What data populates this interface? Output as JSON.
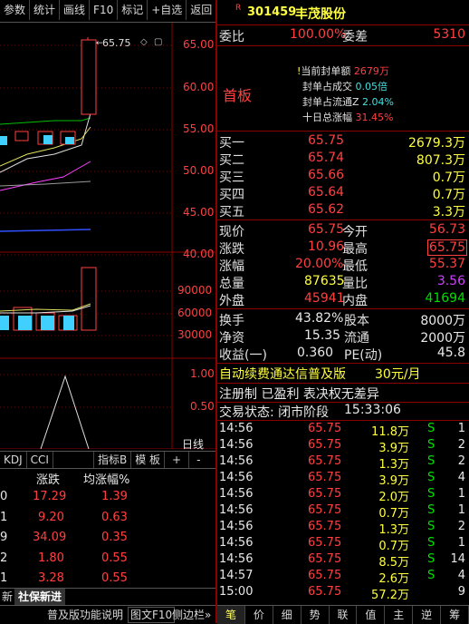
{
  "toolbar": [
    "参数",
    "统计",
    "画线",
    "F10",
    "标记",
    "+自选",
    "返回"
  ],
  "price_axis": [
    "65.00",
    "60.00",
    "55.00",
    "50.00",
    "45.00",
    "40.00"
  ],
  "high_label": "65.75",
  "volume_axis": [
    "90000",
    "60000",
    "30000"
  ],
  "indicator_axis": [
    "1.00",
    "0.50"
  ],
  "period_label": "日线",
  "indicator_tabs": [
    "KDJ",
    "CCI",
    "指标B",
    "模 板",
    "+",
    "-"
  ],
  "sector_table": {
    "headers": [
      "涨跌",
      "均涨幅%"
    ],
    "rows": [
      {
        "idx": "0",
        "chg": "17.29",
        "avg": "1.39"
      },
      {
        "idx": "1",
        "chg": "9.20",
        "avg": "0.63"
      },
      {
        "idx": "9",
        "chg": "34.09",
        "avg": "0.35"
      },
      {
        "idx": "2",
        "chg": "1.80",
        "avg": "0.55"
      },
      {
        "idx": "1",
        "chg": "3.28",
        "avg": "0.55"
      }
    ]
  },
  "news_tab": {
    "prefix": "新",
    "label": "社保新进"
  },
  "left_footer": "普及版功能说明",
  "left_footer_right": "图文F10",
  "left_footer_sidebar": "侧边栏»",
  "stock": {
    "code": "301459",
    "name": "丰茂股份",
    "badge": "R"
  },
  "weibi": {
    "label": "委比",
    "value": "100.00%",
    "cha_label": "委差",
    "cha_value": "5310"
  },
  "limit_up": {
    "title": "首板",
    "rows": [
      {
        "label": "当前封单额",
        "value": "2679万"
      },
      {
        "label": "封单占成交",
        "value": "0.05倍"
      },
      {
        "label": "封单占流通Z",
        "value": "2.04%"
      },
      {
        "label": "十日总涨幅",
        "value": "31.45%"
      }
    ]
  },
  "orderbook": [
    {
      "label": "买一",
      "price": "65.75",
      "vol": "2679.3万"
    },
    {
      "label": "买二",
      "price": "65.74",
      "vol": "807.3万"
    },
    {
      "label": "买三",
      "price": "65.66",
      "vol": "0.7万"
    },
    {
      "label": "买四",
      "price": "65.64",
      "vol": "0.7万"
    },
    {
      "label": "买五",
      "price": "65.62",
      "vol": "3.3万"
    }
  ],
  "quote": [
    {
      "l1": "现价",
      "v1": "65.75",
      "l2": "今开",
      "v2": "56.73"
    },
    {
      "l1": "涨跌",
      "v1": "10.96",
      "l2": "最高",
      "v2": "65.75"
    },
    {
      "l1": "涨幅",
      "v1": "20.00%",
      "l2": "最低",
      "v2": "55.37"
    },
    {
      "l1": "总量",
      "v1": "87635",
      "l2": "量比",
      "v2": "3.56"
    },
    {
      "l1": "外盘",
      "v1": "45941",
      "l2": "内盘",
      "v2": "41694"
    }
  ],
  "fundamentals": [
    {
      "l1": "换手",
      "v1": "43.82%",
      "l2": "股本",
      "v2": "8000万"
    },
    {
      "l1": "净资",
      "v1": "15.35",
      "l2": "流通",
      "v2": "2000万"
    },
    {
      "l1": "收益(一)",
      "v1": "0.360",
      "l2": "PE(动)",
      "v2": "45.8"
    }
  ],
  "ad_text": "自动续费通达信普及版",
  "ad_price": "30元/月",
  "registry_text": "注册制 已盈利 表决权无差异",
  "trade_status": {
    "label": "交易状态: 闭市阶段",
    "time": "15:33:06"
  },
  "ticks": [
    {
      "t": "14:56",
      "p": "65.75",
      "v": "11.8万",
      "d": "S",
      "n": "1"
    },
    {
      "t": "14:56",
      "p": "65.75",
      "v": "3.9万",
      "d": "S",
      "n": "2"
    },
    {
      "t": "14:56",
      "p": "65.75",
      "v": "1.3万",
      "d": "S",
      "n": "2"
    },
    {
      "t": "14:56",
      "p": "65.75",
      "v": "3.9万",
      "d": "S",
      "n": "4"
    },
    {
      "t": "14:56",
      "p": "65.75",
      "v": "2.0万",
      "d": "S",
      "n": "1"
    },
    {
      "t": "14:56",
      "p": "65.75",
      "v": "0.7万",
      "d": "S",
      "n": "1"
    },
    {
      "t": "14:56",
      "p": "65.75",
      "v": "1.3万",
      "d": "S",
      "n": "2"
    },
    {
      "t": "14:56",
      "p": "65.75",
      "v": "0.7万",
      "d": "S",
      "n": "1"
    },
    {
      "t": "14:56",
      "p": "65.75",
      "v": "8.5万",
      "d": "S",
      "n": "14"
    },
    {
      "t": "14:57",
      "p": "65.75",
      "v": "2.6万",
      "d": "S",
      "n": "4"
    },
    {
      "t": "15:00",
      "p": "65.75",
      "v": "57.2万",
      "d": "",
      "n": "9"
    }
  ],
  "bottom_tabs": [
    "笔",
    "价",
    "细",
    "势",
    "联",
    "值",
    "主",
    "逆",
    "筹"
  ],
  "colors": {
    "up": "#ff4040",
    "down": "#00e000",
    "border": "#8b0000",
    "bg": "#000000"
  }
}
